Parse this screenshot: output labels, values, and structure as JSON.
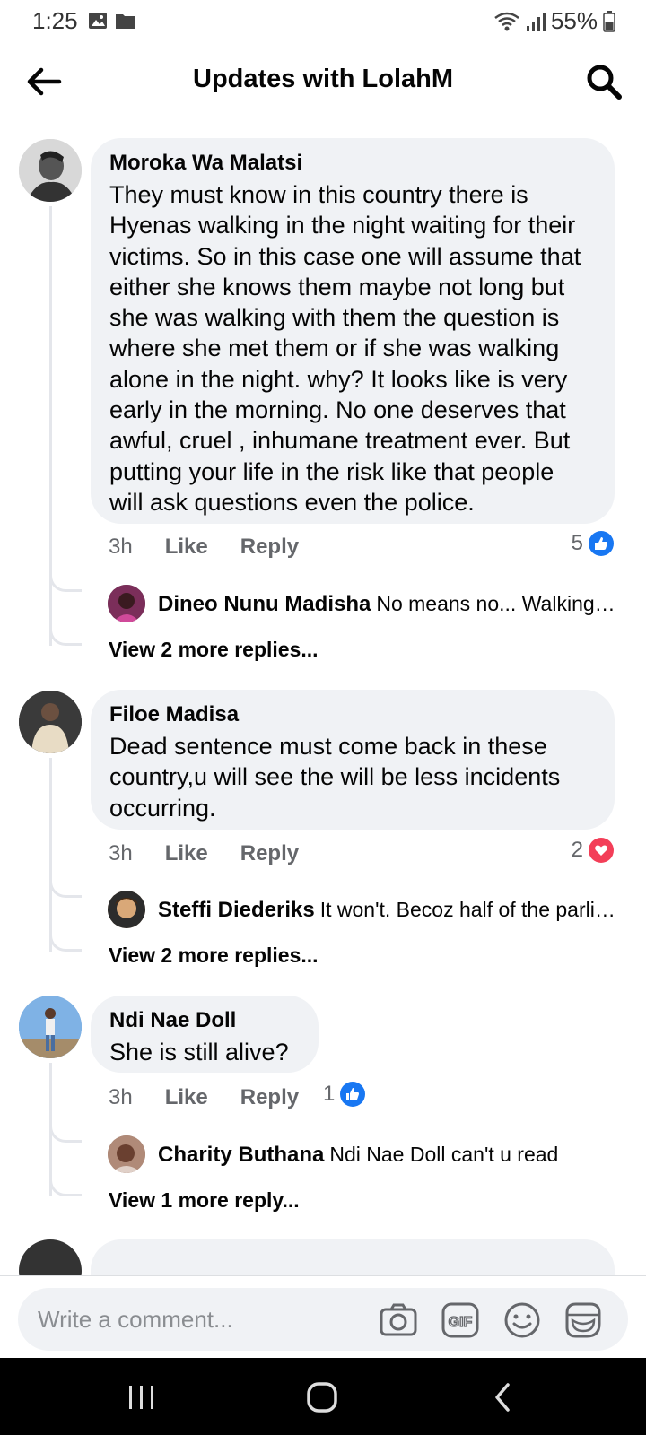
{
  "status_bar": {
    "time": "1:25",
    "battery": "55%"
  },
  "header": {
    "title": "Updates with LolahM"
  },
  "comments": [
    {
      "author": "Moroka Wa Malatsi",
      "lines": [
        "They must know in this country there is",
        "Hyenas walking in the night waiting for their",
        "victims. So in this case one will assume that",
        "either she knows them maybe not long but",
        "she was walking with them the question is",
        "where she met them or if she was walking",
        "alone in the night.  why? It looks like is very",
        "early in the morning. No one deserves that",
        "awful, cruel , inhumane treatment ever. But",
        "putting your life in the risk like that people",
        "will ask questions even the police."
      ],
      "time": "3h",
      "like_label": "Like",
      "reply_label": "Reply",
      "reaction_count": "5",
      "reaction_type": "like",
      "reply_preview": {
        "name": "Dineo Nunu Madisha",
        "text": "No means no... Walking a..."
      },
      "more_replies": "View 2 more replies..."
    },
    {
      "author": "Filoe Madisa",
      "lines": [
        "Dead sentence must come back in these",
        "country,u will see the will be less incidents",
        "occurring."
      ],
      "time": "3h",
      "like_label": "Like",
      "reply_label": "Reply",
      "reaction_count": "2",
      "reaction_type": "love",
      "reply_preview": {
        "name": "Steffi Diederiks",
        "text": "It won't. Becoz half of the parlia..."
      },
      "more_replies": "View 2 more replies..."
    },
    {
      "author": "Ndi Nae Doll",
      "lines": [
        "She is still alive?"
      ],
      "time": "3h",
      "like_label": "Like",
      "reply_label": "Reply",
      "reaction_count": "1",
      "reaction_type": "like",
      "reply_preview": {
        "name": "Charity Buthana",
        "text": "Ndi Nae Doll can't u read"
      },
      "more_replies": "View 1 more reply..."
    }
  ],
  "composer": {
    "placeholder": "Write a comment...",
    "icons": [
      "camera-icon",
      "gif-icon",
      "emoji-icon",
      "sticker-icon"
    ]
  },
  "colors": {
    "like_blue": "#1877f2",
    "love_red": "#f33e58",
    "bubble": "#f0f2f5",
    "muted": "#65676b"
  }
}
